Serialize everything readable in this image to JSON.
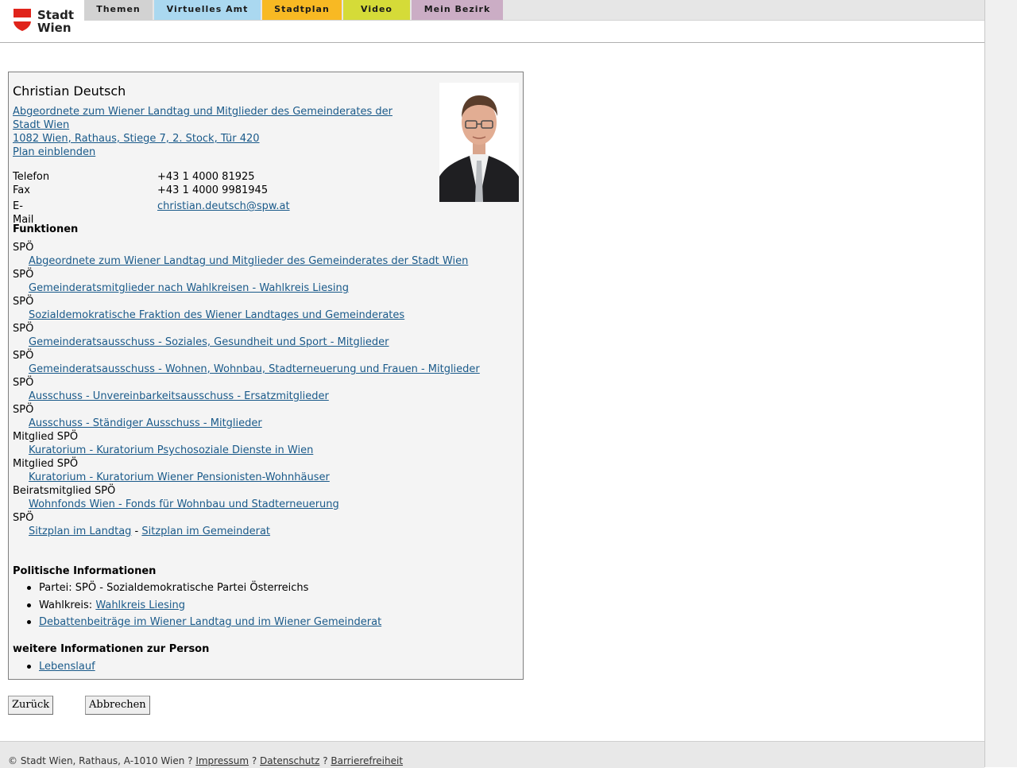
{
  "header": {
    "logo_line1": "Stadt",
    "logo_line2": "Wien",
    "tabs": [
      {
        "label": "Themen",
        "color": "#d2d2d2"
      },
      {
        "label": "Virtuelles Amt",
        "color": "#aad8f0"
      },
      {
        "label": "Stadtplan",
        "color": "#f8b923"
      },
      {
        "label": "Video",
        "color": "#d5db38"
      },
      {
        "label": "Mein Bezirk",
        "color": "#cbadc5"
      }
    ]
  },
  "person": {
    "name": "Christian Deutsch",
    "address": {
      "org_line1": "Abgeordnete zum Wiener Landtag und Mitglieder des Gemeinderates der",
      "org_line2": "Stadt Wien ",
      "street": "1082 Wien, Rathaus, Stiege 7, 2. Stock, Tür 420",
      "plan_link": "Plan einblenden"
    },
    "contact": {
      "phone_label": "Telefon",
      "phone": "+43 1 4000 81925",
      "fax_label": "Fax",
      "fax": "+43 1 4000 9981945",
      "email_label": "E-Mail",
      "email": "christian.deutsch@spw.at"
    }
  },
  "functions": {
    "heading": "Funktionen",
    "items": [
      {
        "party": "SPÖ",
        "link": "Abgeordnete zum Wiener Landtag und Mitglieder des Gemeinderates der Stadt Wien"
      },
      {
        "party": "SPÖ",
        "link": "Gemeinderatsmitglieder nach Wahlkreisen - Wahlkreis Liesing"
      },
      {
        "party": "SPÖ",
        "link": "Sozialdemokratische Fraktion des Wiener Landtages und Gemeinderates"
      },
      {
        "party": "SPÖ",
        "link": "Gemeinderatsausschuss - Soziales, Gesundheit und Sport - Mitglieder"
      },
      {
        "party": "SPÖ",
        "link": "Gemeinderatsausschuss - Wohnen, Wohnbau, Stadterneuerung und Frauen - Mitglieder"
      },
      {
        "party": "SPÖ",
        "link": "Ausschuss - Unvereinbarkeitsausschuss - Ersatzmitglieder"
      },
      {
        "party": "SPÖ",
        "link": "Ausschuss - Ständiger Ausschuss - Mitglieder"
      },
      {
        "party": "Mitglied SPÖ",
        "link": "Kuratorium - Kuratorium Psychosoziale Dienste in Wien"
      },
      {
        "party": "Mitglied SPÖ",
        "link": "Kuratorium - Kuratorium Wiener Pensionisten-Wohnhäuser"
      },
      {
        "party": "Beiratsmitglied SPÖ",
        "link": "Wohnfonds Wien - Fonds für Wohnbau und Stadterneuerung"
      }
    ],
    "last_party": "SPÖ",
    "seat_landtag": "Sitzplan im Landtag",
    "seat_sep": " - ",
    "seat_gemeinderat": "Sitzplan im Gemeinderat"
  },
  "political": {
    "heading": "Politische Informationen",
    "party_text": "Partei: SPÖ - Sozialdemokratische Partei Österreichs",
    "wahlkreis_label": "Wahlkreis: ",
    "wahlkreis_link": "Wahlkreis Liesing",
    "debate_link": "Debattenbeiträge im Wiener Landtag und im Wiener Gemeinderat"
  },
  "more_info": {
    "heading": "weitere Informationen zur Person",
    "cv_link": "Lebenslauf"
  },
  "buttons": {
    "back": "Zurück",
    "cancel": "Abbrechen"
  },
  "footer": {
    "copyright": "© Stadt Wien, Rathaus, A-1010 Wien ? ",
    "impressum": "Impressum",
    "sep1": " ? ",
    "datenschutz": "Datenschutz",
    "sep2": " ? ",
    "barrierefreiheit": "Barrierefreiheit"
  }
}
